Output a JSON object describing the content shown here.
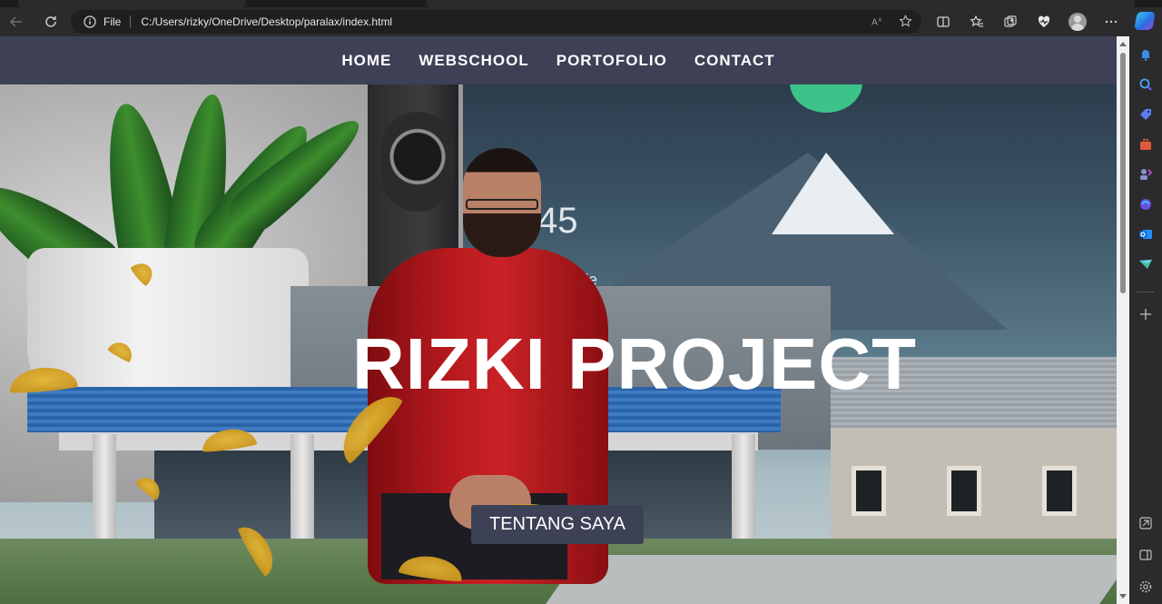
{
  "browser": {
    "file_label": "File",
    "url": "C:/Users/rizky/OneDrive/Desktop/paralax/index.html"
  },
  "nav": {
    "items": [
      "HOME",
      "WEBSCHOOL",
      "PORTOFOLIO",
      "CONTACT"
    ]
  },
  "hero": {
    "title": "RIZKI PROJECT",
    "button_label": "TENTANG SAYA"
  },
  "colors": {
    "navbar_bg": "#3e4056",
    "button_bg": "#3c4156",
    "text": "#ffffff"
  },
  "icons": {
    "toolbar": [
      "back-icon",
      "refresh-icon",
      "info-icon",
      "read-aloud-icon",
      "favorite-star-icon",
      "split-screen-icon",
      "favorites-icon",
      "collections-icon",
      "browser-essentials-icon",
      "profile-avatar-icon",
      "more-icon",
      "copilot-icon"
    ],
    "sidebar": [
      "bell-icon",
      "search-icon",
      "tag-icon",
      "toolbox-icon",
      "games-icon",
      "copilot-sidebar-icon",
      "outlook-icon",
      "send-icon",
      "add-icon",
      "screenshot-icon",
      "sidebar-toggle-icon",
      "settings-icon"
    ]
  }
}
